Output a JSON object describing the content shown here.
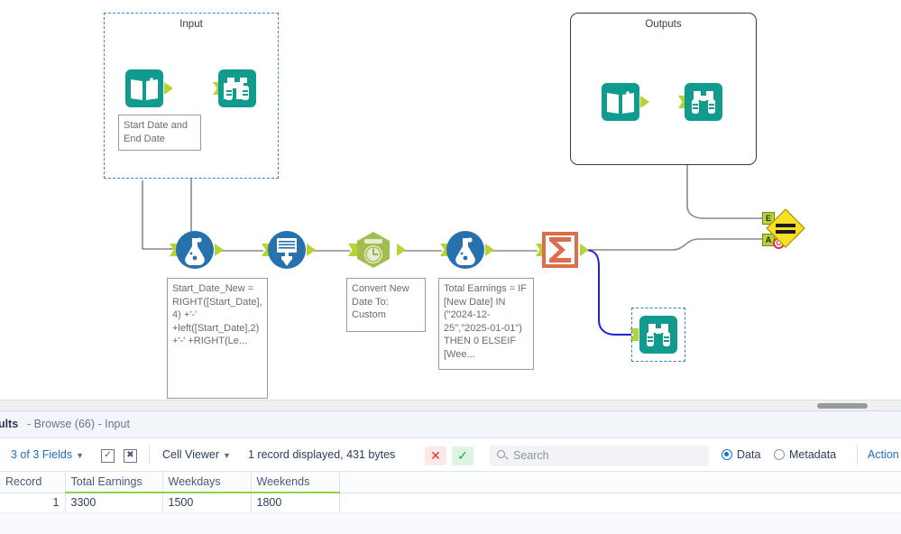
{
  "canvas": {
    "containers": [
      {
        "name": "input-container",
        "title": "Input"
      },
      {
        "name": "outputs-container",
        "title": "Outputs"
      }
    ],
    "annotations": [
      {
        "name": "input-annotation",
        "text": "Start Date and End Date"
      },
      {
        "name": "formula-1-annotation",
        "text": "Start_Date_New = RIGHT([Start_Date],4) +'-' +left([Start_Date],2) +'-' +RIGHT(Le..."
      },
      {
        "name": "datetime-annotation",
        "text": "Convert New Date To: Custom"
      },
      {
        "name": "formula-2-annotation",
        "text": "Total Earnings = IF [New Date] IN (\"2024-12-25\",\"2025-01-01\") THEN 0 ELSEIF [Wee..."
      }
    ],
    "tools": [
      {
        "name": "input-data-tool",
        "icon": "book-icon",
        "color": "#0f9b8e"
      },
      {
        "name": "browse-tool-input",
        "icon": "binoculars-icon",
        "color": "#0f9b8e"
      },
      {
        "name": "input-data-tool-outputs",
        "icon": "book-icon",
        "color": "#0f9b8e"
      },
      {
        "name": "browse-tool-outputs",
        "icon": "binoculars-icon",
        "color": "#0f9b8e"
      },
      {
        "name": "formula-tool-1",
        "icon": "flask-icon",
        "color": "#2671ae"
      },
      {
        "name": "select-tool",
        "icon": "select-icon",
        "color": "#2671ae"
      },
      {
        "name": "datetime-tool",
        "icon": "clock-icon",
        "color": "#a3bd4e"
      },
      {
        "name": "formula-tool-2",
        "icon": "flask-icon",
        "color": "#2671ae"
      },
      {
        "name": "summarize-tool",
        "icon": "sigma-icon",
        "color": "#dd6e4c"
      },
      {
        "name": "join-tool",
        "icon": "equals-diamond-icon",
        "color": "#f7e026"
      },
      {
        "name": "browse-tool-selected",
        "icon": "binoculars-icon",
        "color": "#0f9b8e"
      }
    ],
    "join_anchors": {
      "expected": "E",
      "actual": "A",
      "error_marker": "C"
    }
  },
  "results": {
    "title": "sults",
    "subtitle": "- Browse (66) - Input",
    "toolbar": {
      "fields_label": "3 of 3 Fields",
      "select_all_icon": "checkbox-checked-icon",
      "deselect_all_icon": "checkbox-cross-icon",
      "cell_viewer_label": "Cell Viewer",
      "record_status": "1 record displayed, 431 bytes",
      "reject_label": "✕",
      "accept_label": "✓",
      "search_placeholder": "Search",
      "data_label": "Data",
      "metadata_label": "Metadata",
      "actions_label": "Action"
    },
    "table": {
      "headers": [
        "Record",
        "Total Earnings",
        "Weekdays",
        "Weekends"
      ],
      "rows": [
        [
          "1",
          "3300",
          "1500",
          "1800"
        ]
      ]
    }
  }
}
